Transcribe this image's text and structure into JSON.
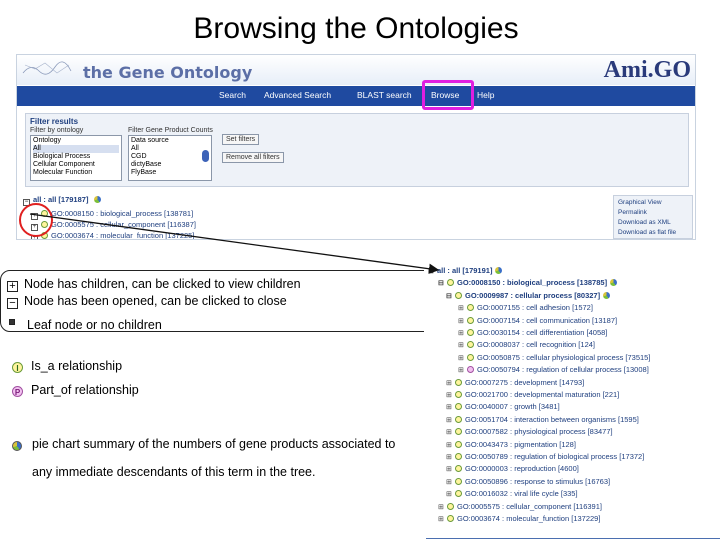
{
  "slide_title": "Browsing the Ontologies",
  "header": {
    "logo_text": "the Gene Ontology",
    "amigo_logo": "Ami.GO"
  },
  "nav": {
    "items": [
      "Search",
      "Advanced Search",
      "BLAST search",
      "Browse",
      "Help"
    ],
    "highlighted": "Browse"
  },
  "filter_panel": {
    "title": "Filter results",
    "by_ontology_label": "Filter by ontology",
    "ontology_options": [
      "Ontology",
      "All",
      "Biological Process",
      "Cellular Component",
      "Molecular Function"
    ],
    "ontology_selected": "All",
    "gene_product_label": "Filter Gene Product Counts",
    "datasource_options": [
      "Data source",
      "All",
      "CGD",
      "dictyBase",
      "FlyBase"
    ],
    "datasource_selected": "All",
    "set_filters_button": "Set filters",
    "remove_filters_button": "Remove all filters"
  },
  "top_tree": {
    "root": "all : all  [179187]",
    "rows": [
      "GO:0008150 : biological_process  [138781]",
      "GO:0005575 : cellular_component  [116387]",
      "GO:0003674 : molecular_function  [137225]"
    ]
  },
  "side_panel": {
    "links": [
      "Graphical View",
      "Permalink",
      "Download as XML",
      "Download as flat file"
    ]
  },
  "legend": {
    "plus_text": "Node has children, can be clicked to view children",
    "minus_text": "Node has been opened, can be clicked to close",
    "leaf_text": "Leaf node or no children",
    "is_a_text": "Is_a relationship",
    "part_of_text": "Part_of relationship",
    "pie_line1": "pie chart summary of the numbers of gene products associated to",
    "pie_line2": "any immediate descendants of this term in the tree."
  },
  "colors": {
    "nav_bar": "#1f4aa0",
    "browse_highlight": "#e01ee0",
    "red_circle": "#e02020",
    "link_text": "#1f3f7f"
  },
  "detail_tree": [
    {
      "mark": "⊟",
      "icon": "none",
      "text": "all : all  [179191]",
      "bold": true,
      "pie": true
    },
    {
      "mark": "⊟",
      "icon": "y",
      "text": "GO:0008150 : biological_process  [138785]",
      "bold": true,
      "pie": true
    },
    {
      "mark": "⊟",
      "icon": "y",
      "text": "GO:0009987 : cellular process  [80327]",
      "bold": true,
      "pie": true
    },
    {
      "mark": "⊞",
      "icon": "y",
      "text": "GO:0007155 : cell adhesion  [1572]",
      "bold": false,
      "pie": false
    },
    {
      "mark": "⊞",
      "icon": "y",
      "text": "GO:0007154 : cell communication  [13187]",
      "bold": false,
      "pie": false
    },
    {
      "mark": "⊞",
      "icon": "y",
      "text": "GO:0030154 : cell differentiation  [4058]",
      "bold": false,
      "pie": false
    },
    {
      "mark": "⊞",
      "icon": "y",
      "text": "GO:0008037 : cell recognition  [124]",
      "bold": false,
      "pie": false
    },
    {
      "mark": "⊞",
      "icon": "y",
      "text": "GO:0050875 : cellular physiological process  [73515]",
      "bold": false,
      "pie": false
    },
    {
      "mark": "⊞",
      "icon": "p",
      "text": "GO:0050794 : regulation of cellular process  [13008]",
      "bold": false,
      "pie": false
    },
    {
      "mark": "⊞",
      "icon": "y",
      "text": "GO:0007275 : development  [14793]",
      "bold": false,
      "pie": false
    },
    {
      "mark": "⊞",
      "icon": "y",
      "text": "GO:0021700 : developmental maturation  [221]",
      "bold": false,
      "pie": false
    },
    {
      "mark": "⊞",
      "icon": "y",
      "text": "GO:0040007 : growth  [3481]",
      "bold": false,
      "pie": false
    },
    {
      "mark": "⊞",
      "icon": "y",
      "text": "GO:0051704 : interaction between organisms  [1595]",
      "bold": false,
      "pie": false
    },
    {
      "mark": "⊞",
      "icon": "y",
      "text": "GO:0007582 : physiological process  [83477]",
      "bold": false,
      "pie": false
    },
    {
      "mark": "⊞",
      "icon": "y",
      "text": "GO:0043473 : pigmentation  [128]",
      "bold": false,
      "pie": false
    },
    {
      "mark": "⊞",
      "icon": "y",
      "text": "GO:0050789 : regulation of biological process  [17372]",
      "bold": false,
      "pie": false
    },
    {
      "mark": "⊞",
      "icon": "y",
      "text": "GO:0000003 : reproduction  [4600]",
      "bold": false,
      "pie": false
    },
    {
      "mark": "⊞",
      "icon": "y",
      "text": "GO:0050896 : response to stimulus  [16763]",
      "bold": false,
      "pie": false
    },
    {
      "mark": "⊞",
      "icon": "y",
      "text": "GO:0016032 : viral life cycle  [335]",
      "bold": false,
      "pie": false
    },
    {
      "mark": "⊞",
      "icon": "y",
      "text": "GO:0005575 : cellular_component  [116391]",
      "bold": false,
      "pie": false
    },
    {
      "mark": "⊞",
      "icon": "y",
      "text": "GO:0003674 : molecular_function  [137229]",
      "bold": false,
      "pie": false
    }
  ]
}
